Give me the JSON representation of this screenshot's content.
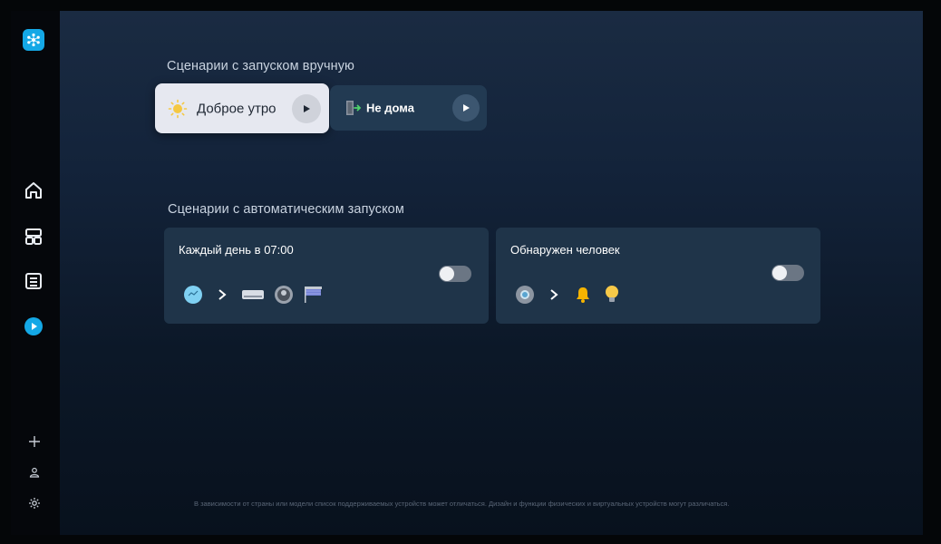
{
  "sidebar": {
    "logo_icon": "smartthings-logo-icon",
    "nav": [
      {
        "name": "home",
        "icon": "home-icon"
      },
      {
        "name": "devices",
        "icon": "dashboard-icon"
      },
      {
        "name": "list",
        "icon": "list-icon"
      },
      {
        "name": "scenes",
        "icon": "play-circle-icon",
        "active": true
      }
    ],
    "bottom": [
      {
        "name": "add",
        "icon": "plus-icon"
      },
      {
        "name": "account",
        "icon": "person-icon"
      },
      {
        "name": "settings",
        "icon": "gear-icon"
      }
    ]
  },
  "manual": {
    "title": "Сценарии с запуском вручную",
    "cards": [
      {
        "label": "Доброе утро",
        "icon": "sun-icon",
        "focused": true
      },
      {
        "label": "Не дома",
        "icon": "door-exit-icon",
        "focused": false
      }
    ]
  },
  "auto": {
    "title": "Сценарии с автоматическим запуском",
    "cards": [
      {
        "title": "Каждый день в 07:00",
        "enabled": false,
        "trigger_icon": "clock-icon",
        "actions": [
          "air-conditioner-icon",
          "robot-vacuum-icon",
          "blinds-icon"
        ]
      },
      {
        "title": "Обнаружен человек",
        "enabled": false,
        "trigger_icon": "motion-sensor-icon",
        "actions": [
          "bell-icon",
          "lightbulb-icon"
        ]
      }
    ]
  },
  "disclaimer": "В зависимости от страны или модели список поддерживаемых устройств может отличаться. Дизайн и функции физических и виртуальных устройств могут различаться.",
  "colors": {
    "accent": "#14a8e6",
    "card": "#1f3449",
    "focused_card": "#e6e8f0"
  }
}
